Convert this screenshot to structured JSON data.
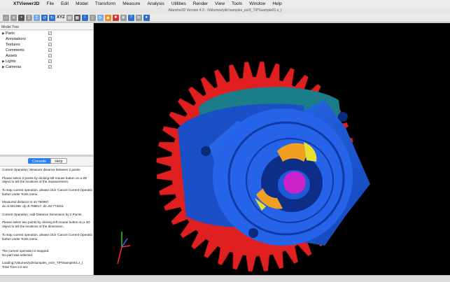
{
  "menubar": {
    "app": "XTViewer3D",
    "items": [
      "File",
      "Edit",
      "Model",
      "Transform",
      "Measure",
      "Analysis",
      "Utilities",
      "Render",
      "View",
      "Tools",
      "Window",
      "Help"
    ]
  },
  "window": {
    "title": "Afanche3D Version 4.3 - /Volumes/ydir/samples_ex/X_T/PSsample01.x_t"
  },
  "toolbar": {
    "xyz_label": "XYZ"
  },
  "tree": {
    "header": "Model Tree",
    "items": [
      {
        "label": "Parts",
        "expandable": true,
        "checked": true
      },
      {
        "label": "Annotations",
        "expandable": false,
        "checked": true
      },
      {
        "label": "Textures",
        "expandable": false,
        "checked": true
      },
      {
        "label": "Comments",
        "expandable": false,
        "checked": true
      },
      {
        "label": "Assets",
        "expandable": false,
        "checked": true
      },
      {
        "label": "Lights",
        "expandable": true,
        "checked": true
      },
      {
        "label": "Cameras",
        "expandable": true,
        "checked": true
      }
    ]
  },
  "tabs": {
    "console": "Console",
    "help": "Help"
  },
  "console_lines": [
    "Current Operation: Measure distance between 2 points",
    "",
    "Please select 2 points by clicking left mouse button on a 3D",
    "object to tell the locations of the measurement.",
    "",
    "To stop current operation, please click 'Cancel Current Operatio",
    "button under Tools menu.",
    "",
    "Measured distance is 42.784987",
    "dx=0.591399, dy=0.798817, dz=42.773441",
    "",
    "Current Operation: Add Distance Dimension by 2 Points",
    "",
    "Please select two points by clicking left mouse button on a 3D",
    "object to tell the locations of the dimension.",
    "",
    "To stop current operation, please click 'Cancel Current Operatio",
    "button under Tools menu.",
    "",
    "",
    "The current operation is stopped.",
    "No part was selected.",
    "",
    "Loading:/Volumes/ydir/samples_ex/X_T/PSsample01.x_t",
    "Total Time:2.0 sec"
  ],
  "colors": {
    "gear": "#e02020",
    "housing": "#1e5fe0",
    "hub": "#cc22cc",
    "viewport_bg": "#000000",
    "tab_active": "#2a7ef3"
  }
}
